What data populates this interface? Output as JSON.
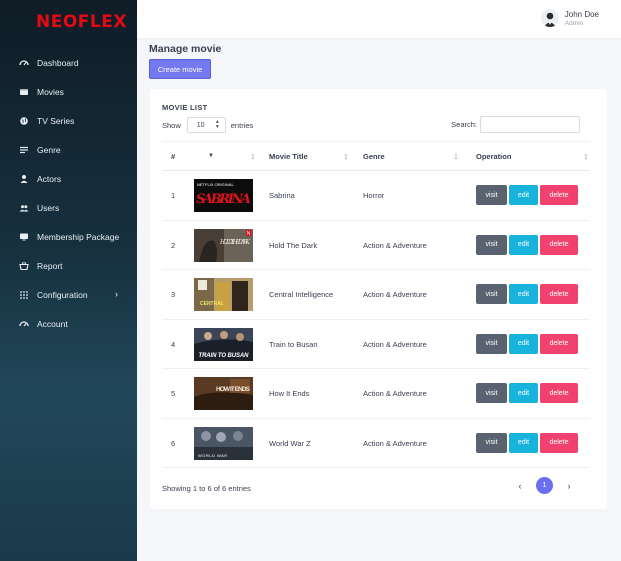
{
  "app": {
    "logo": "NEOFLEX",
    "brand_color": "#e50914",
    "accent": "#7479f0"
  },
  "sidebar": {
    "items": [
      {
        "label": "Dashboard",
        "icon": "speedometer-icon"
      },
      {
        "label": "Movies",
        "icon": "film-icon"
      },
      {
        "label": "TV Series",
        "icon": "globe-icon"
      },
      {
        "label": "Genre",
        "icon": "list-icon"
      },
      {
        "label": "Actors",
        "icon": "person-icon"
      },
      {
        "label": "Users",
        "icon": "users-icon"
      },
      {
        "label": "Membership Package",
        "icon": "monitor-icon"
      },
      {
        "label": "Report",
        "icon": "basket-icon"
      },
      {
        "label": "Configuration",
        "icon": "grid-icon",
        "has_submenu": true
      },
      {
        "label": "Account",
        "icon": "speedometer-icon"
      }
    ]
  },
  "header": {
    "user_name": "John Doe",
    "user_role": "Admin"
  },
  "main": {
    "title": "Manage movie",
    "create_button": "Create movie",
    "card_title": "MOVIE LIST",
    "show_label": "Show",
    "page_size": "10",
    "entries_label": "entries",
    "search_label": "Search:",
    "search_value": "",
    "columns": [
      "#",
      "",
      "Movie Title",
      "Genre",
      "Operation"
    ],
    "rows": [
      {
        "num": "1",
        "title": "Sabrina",
        "genre": "Horror",
        "poster_text": "SABRINA",
        "poster_tag": "NETFLIX ORIGINAL"
      },
      {
        "num": "2",
        "title": "Hold The Dark",
        "genre": "Action & Adventure",
        "poster_text": "HOLD THE DARK",
        "poster_tag": "N"
      },
      {
        "num": "3",
        "title": "Central Intelligence",
        "genre": "Action & Adventure",
        "poster_text": "CENTRAL",
        "poster_tag": ""
      },
      {
        "num": "4",
        "title": "Train to Busan",
        "genre": "Action & Adventure",
        "poster_text": "TRAIN TO BUSAN",
        "poster_tag": ""
      },
      {
        "num": "5",
        "title": "How It Ends",
        "genre": "Action & Adventure",
        "poster_text": "HOW IT ENDS",
        "poster_tag": ""
      },
      {
        "num": "6",
        "title": "World War Z",
        "genre": "Action & Adventure",
        "poster_text": "WORLD WAR",
        "poster_tag": ""
      }
    ],
    "actions": {
      "visit": "visit",
      "edit": "edit",
      "delete": "delete"
    },
    "showing_text": "Showing 1 to 6 of 6 entries",
    "pagination": {
      "prev": "‹",
      "current": "1",
      "next": "›"
    }
  }
}
